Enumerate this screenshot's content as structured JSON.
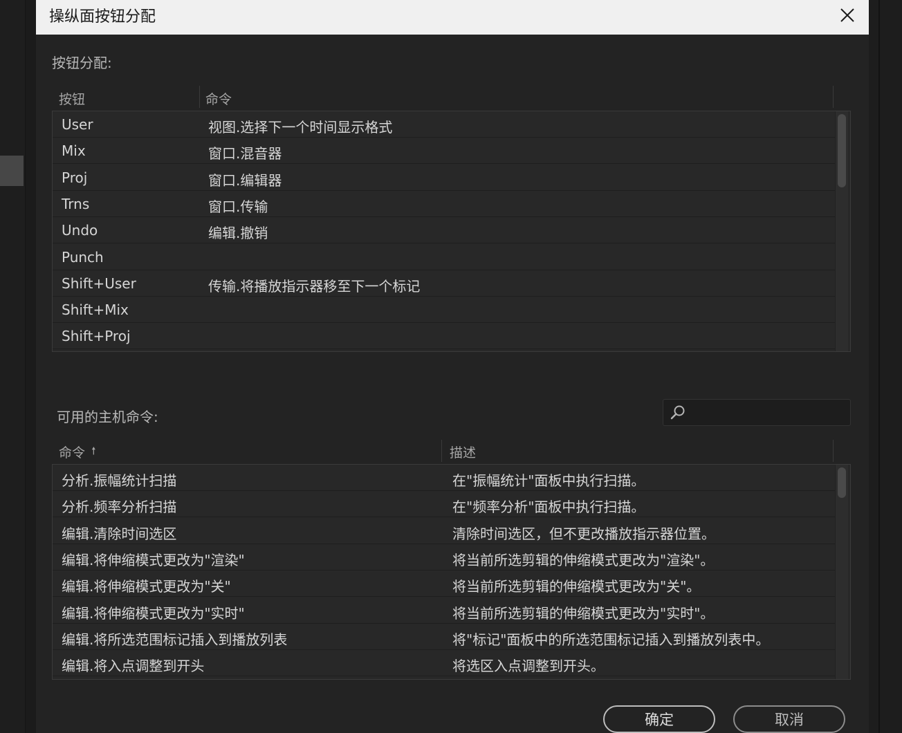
{
  "dialog": {
    "title": "操纵面按钮分配",
    "close_glyph": "✕"
  },
  "assignments": {
    "label": "按钮分配:",
    "headers": {
      "button": "按钮",
      "command": "命令"
    },
    "rows": [
      {
        "button": "User",
        "command": "视图.选择下一个时间显示格式"
      },
      {
        "button": "Mix",
        "command": "窗口.混音器"
      },
      {
        "button": "Proj",
        "command": "窗口.编辑器"
      },
      {
        "button": "Trns",
        "command": "窗口.传输"
      },
      {
        "button": "Undo",
        "command": "编辑.撤销"
      },
      {
        "button": "Punch",
        "command": ""
      },
      {
        "button": "Shift+User",
        "command": "传输.将播放指示器移至下一个标记"
      },
      {
        "button": "Shift+Mix",
        "command": ""
      },
      {
        "button": "Shift+Proj",
        "command": ""
      }
    ]
  },
  "host_commands": {
    "label": "可用的主机命令:",
    "search": {
      "value": "",
      "icon": "search-icon"
    },
    "headers": {
      "command": "命令",
      "sort_arrow": "🠕",
      "description": "描述"
    },
    "rows": [
      {
        "command": "分析.振幅统计扫描",
        "description": "在\"振幅统计\"面板中执行扫描。"
      },
      {
        "command": "分析.频率分析扫描",
        "description": "在\"频率分析\"面板中执行扫描。"
      },
      {
        "command": "编辑.清除时间选区",
        "description": "清除时间选区，但不更改播放指示器位置。"
      },
      {
        "command": "编辑.将伸缩模式更改为\"渲染\"",
        "description": "将当前所选剪辑的伸缩模式更改为\"渲染\"。"
      },
      {
        "command": "编辑.将伸缩模式更改为\"关\"",
        "description": "将当前所选剪辑的伸缩模式更改为\"关\"。"
      },
      {
        "command": "编辑.将伸缩模式更改为\"实时\"",
        "description": "将当前所选剪辑的伸缩模式更改为\"实时\"。"
      },
      {
        "command": "编辑.将所选范围标记插入到播放列表",
        "description": "将\"标记\"面板中的所选范围标记插入到播放列表中。"
      },
      {
        "command": "编辑.将入点调整到开头",
        "description": "将选区入点调整到开头。"
      }
    ]
  },
  "footer": {
    "ok_label": "确定",
    "cancel_label": "取消"
  }
}
